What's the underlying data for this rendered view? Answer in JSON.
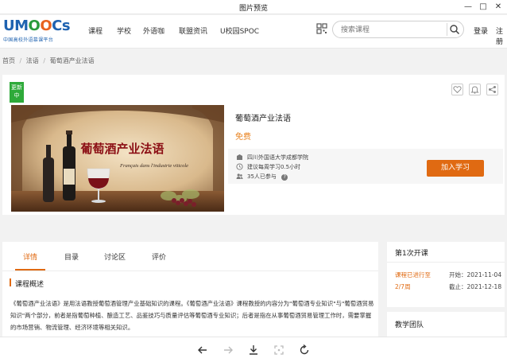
{
  "window": {
    "title": "图片预览",
    "minimize": "—",
    "maximize": "□",
    "close": "✕"
  },
  "logo": {
    "u": "U",
    "m": "M",
    "o1": "O",
    "o2": "O",
    "cs": "Cs",
    "subtitle": "中国高校外语慕课平台"
  },
  "nav": {
    "items": [
      "课程",
      "学校",
      "外语咖",
      "联盟资讯",
      "U校园SPOC"
    ]
  },
  "search": {
    "placeholder": "搜索课程"
  },
  "header_links": {
    "login": "登录",
    "register": "注册"
  },
  "breadcrumb": {
    "items": [
      "首页",
      "法语",
      "葡萄酒产业法语"
    ],
    "separator": "/"
  },
  "course": {
    "badge": "更新中",
    "title": "葡萄酒产业法语",
    "price": "免费",
    "cover_title": "葡萄酒产业法语",
    "cover_subtitle": "Français dans l'industrie viticole",
    "school": "四川外国语大学成都学院",
    "study_time": "建议每周学习0.5小时",
    "participants": "35人已参与",
    "help": "?",
    "enroll_label": "加入学习"
  },
  "tabs": {
    "items": [
      "详情",
      "目录",
      "讨论区",
      "评价"
    ],
    "active_index": 0
  },
  "overview": {
    "heading": "课程概述",
    "text": "《葡萄酒产业法语》是用法语教授葡萄酒管理产业基础知识的课程。《葡萄酒产业法语》课程教授的内容分为\"葡萄酒专业知识\"与\"葡萄酒贸易知识\"两个部分，前者是指葡萄种植、酿造工艺、品鉴技巧与质量评估等葡萄酒专业知识；后者是指在从事葡萄酒贸易管理工作时，需要掌握的市场营销、物流管理、经济环境等相关知识。"
  },
  "session": {
    "title": "第1次开课",
    "status": "课程已进行至",
    "progress": "2/7周",
    "start_label": "开始：",
    "start_date": "2021-11-04",
    "end_label": "截止：",
    "end_date": "2021-12-18"
  },
  "team": {
    "title": "教学团队"
  },
  "colors": {
    "accent": "#e06a12",
    "brand": "#1e62b0",
    "badge": "#2eaa3a"
  }
}
